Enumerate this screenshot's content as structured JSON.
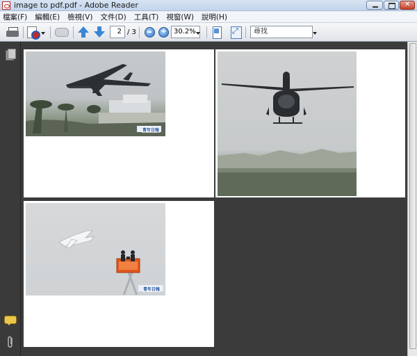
{
  "window": {
    "title": "image to pdf.pdf - Adobe Reader"
  },
  "menu": {
    "items": [
      "檔案(F)",
      "編輯(E)",
      "檢視(V)",
      "文件(D)",
      "工具(T)",
      "視窗(W)",
      "說明(H)"
    ]
  },
  "toolbar": {
    "page_current": "2",
    "page_total": "/ 3",
    "zoom": "30.2%",
    "search_placeholder": "尋找"
  },
  "document": {
    "pages": [
      {
        "photo": "fighter-jet-taking-off",
        "watermark": "青年日報"
      },
      {
        "photo": "helicopter-hovering",
        "watermark": ""
      },
      {
        "photo": "fighter-jet-and-photographers-on-lift",
        "watermark": "青年日報"
      }
    ]
  }
}
